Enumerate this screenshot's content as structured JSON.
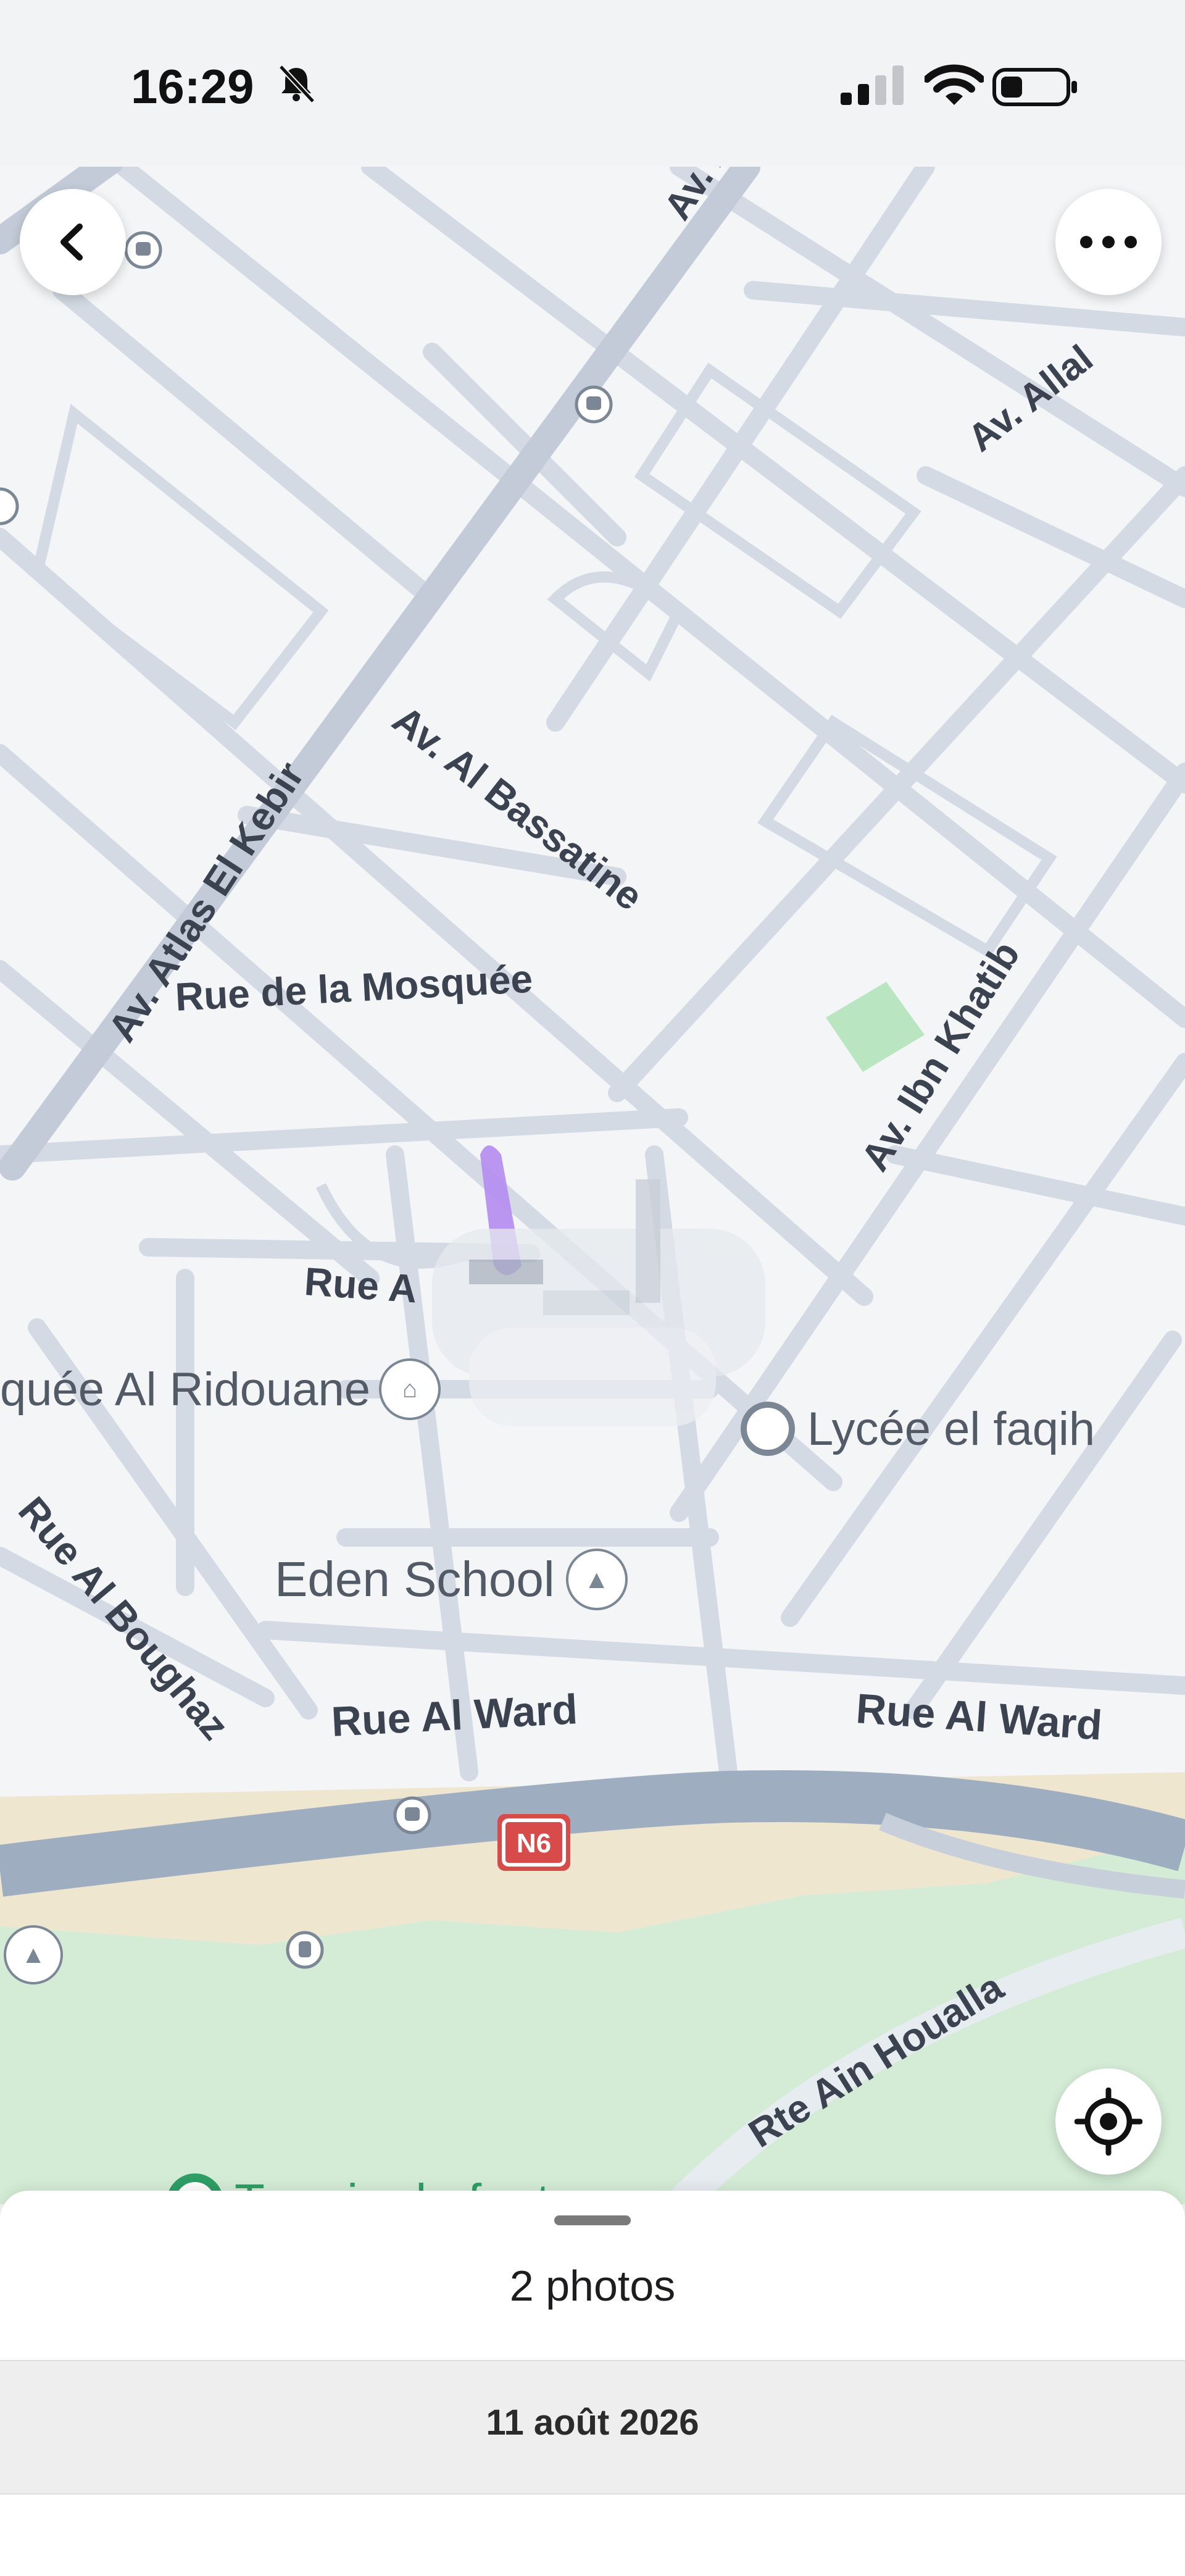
{
  "status_bar": {
    "time": "16:29",
    "icons": [
      "bell-slash-icon",
      "cellular-signal-icon",
      "wifi-icon",
      "battery-icon"
    ]
  },
  "map": {
    "street_labels": [
      "Av. Al",
      "Av. Allal",
      "Av. Atlas El Kebir",
      "Av. Al Bassatine",
      "Av. Ibn Khatib",
      "Rue de la Mosquée",
      "Rue A",
      "Rue Al Boughaz",
      "Rue Al Ward",
      "Rue Al Ward",
      "Rte Ain Houalla"
    ],
    "places": {
      "mosque": "quée Al Ridouane",
      "lycee": "Lycée el faqih",
      "school": "Eden School",
      "park": "Terrain de foot",
      "route_shield": "N6"
    },
    "colors": {
      "land": "#f4f5f7",
      "road": "#d3dae3",
      "highway": "#9eadc0",
      "park": "#d4ecd6",
      "sand": "#efe6d0",
      "pin_purple": "#b48cf0",
      "place_green": "#2e9e65"
    }
  },
  "controls": {
    "back": "chevron-left-icon",
    "more": "more-dots-icon",
    "locate": "locate-target-icon"
  },
  "sheet": {
    "photos_label": "2 photos",
    "date": "11 août 2026"
  }
}
